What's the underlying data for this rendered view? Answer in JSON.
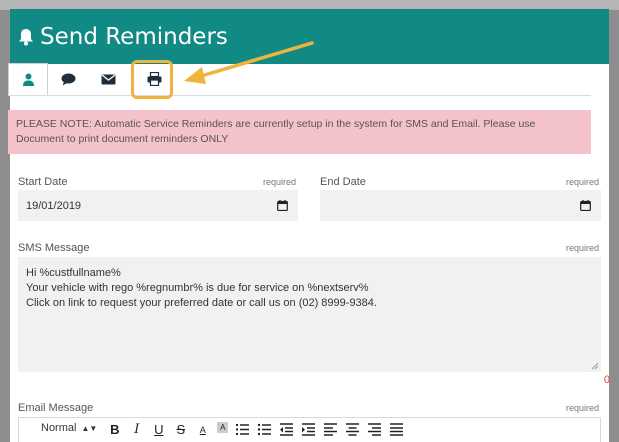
{
  "header": {
    "title": "Send Reminders"
  },
  "notice": "PLEASE NOTE: Automatic Service Reminders are currently setup in the system for SMS and Email. Please use Document to print document reminders ONLY",
  "form": {
    "start_date": {
      "label": "Start Date",
      "required": "required",
      "value": "19/01/2019"
    },
    "end_date": {
      "label": "End Date",
      "required": "required",
      "value": ""
    },
    "sms": {
      "label": "SMS Message",
      "required": "required",
      "lines": [
        "Hi %custfullname%",
        "Your vehicle with rego %regnumbr% is due for service on %nextserv%",
        "Click on link to request your preferred date or call us on (02) 8999-9384."
      ],
      "counter": "0"
    },
    "email": {
      "label": "Email Message",
      "required": "required",
      "format_select": "Normal"
    }
  },
  "colors": {
    "header": "#118a85",
    "notice_bg": "#f4c2ca",
    "highlight": "#f0b43b",
    "counter": "#e04b3a"
  },
  "icons": {
    "tabs": [
      "user-icon",
      "chat-bubble-icon",
      "envelope-icon",
      "printer-icon"
    ]
  }
}
